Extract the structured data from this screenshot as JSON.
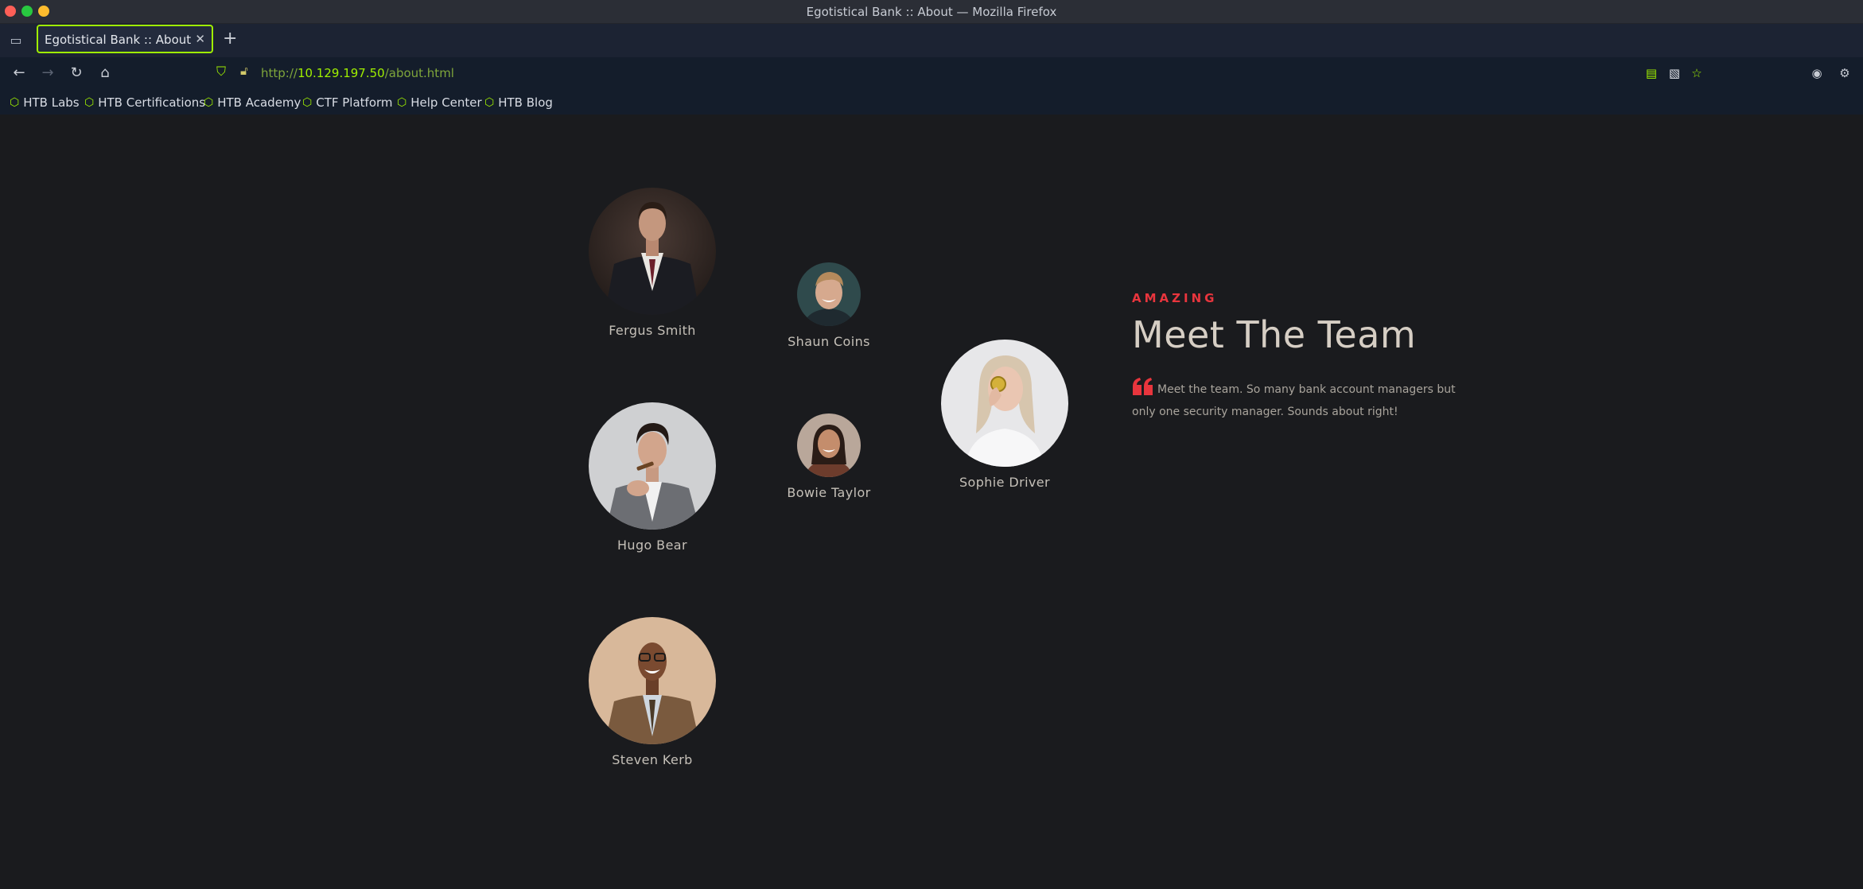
{
  "window": {
    "title": "Egotistical Bank :: About — Mozilla Firefox"
  },
  "tabs": [
    {
      "label": "Egotistical Bank :: About"
    }
  ],
  "url": {
    "scheme": "http://",
    "host": "10.129.197.50",
    "path": "/about.html"
  },
  "bookmarks": [
    {
      "label": "HTB Labs"
    },
    {
      "label": "HTB Certifications"
    },
    {
      "label": "HTB Academy"
    },
    {
      "label": "CTF Platform"
    },
    {
      "label": "Help Center"
    },
    {
      "label": "HTB Blog"
    }
  ],
  "team": {
    "eyebrow": "AMAZING",
    "heading": "Meet The Team",
    "quote": "Meet the team. So many bank account managers but only one security manager. Sounds about right!",
    "members": [
      {
        "name": "Fergus Smith"
      },
      {
        "name": "Shaun Coins"
      },
      {
        "name": "Sophie Driver"
      },
      {
        "name": "Hugo Bear"
      },
      {
        "name": "Bowie Taylor"
      },
      {
        "name": "Steven Kerb"
      }
    ]
  },
  "colors": {
    "accent_red": "#e8353d",
    "htb_green": "#9fef00",
    "page_bg": "#1a1b1e",
    "chrome_bg": "#141d2b"
  }
}
